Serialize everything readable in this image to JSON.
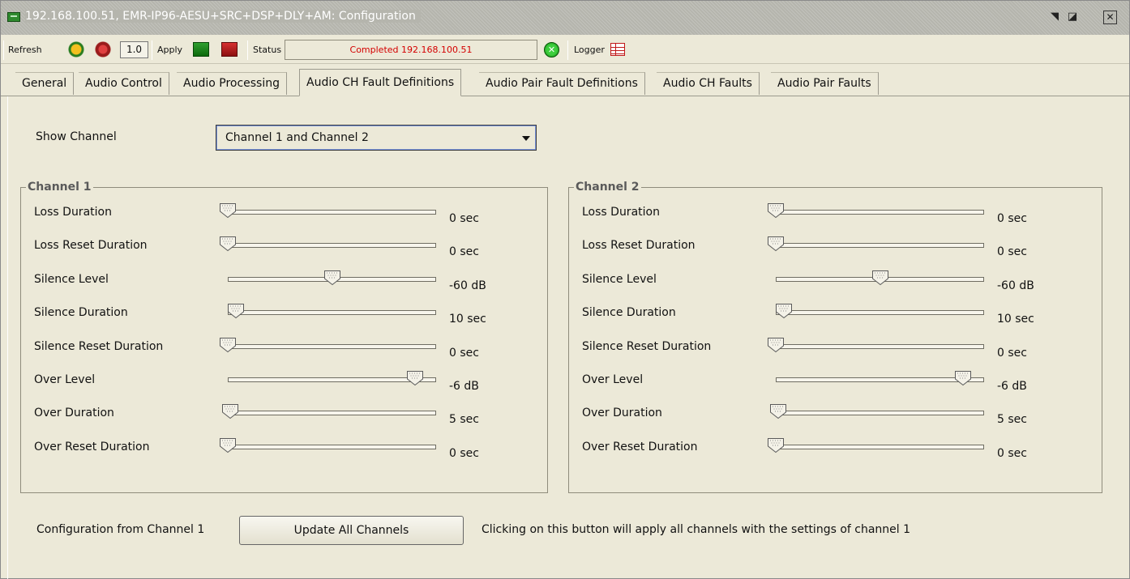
{
  "window": {
    "title": "192.168.100.51, EMR-IP96-AESU+SRC+DSP+DLY+AM: Configuration"
  },
  "toolbar": {
    "refresh_label": "Refresh",
    "version": "1.0",
    "apply_label": "Apply",
    "status_label": "Status",
    "status_text": "Completed 192.168.100.51",
    "logger_label": "Logger"
  },
  "tabs": [
    {
      "label": "General"
    },
    {
      "label": "Audio Control"
    },
    {
      "label": "Audio Processing"
    },
    {
      "label": "Audio CH Fault Definitions",
      "active": true
    },
    {
      "label": "Audio Pair Fault Definitions"
    },
    {
      "label": "Audio CH Faults"
    },
    {
      "label": "Audio Pair Faults"
    }
  ],
  "show_channel": {
    "label": "Show Channel",
    "selected": "Channel 1 and Channel 2"
  },
  "channel1": {
    "title": "Channel 1",
    "rows": [
      {
        "label": "Loss Duration",
        "value": "0 sec",
        "position": 0.0
      },
      {
        "label": "Loss Reset Duration",
        "value": "0 sec",
        "position": 0.0
      },
      {
        "label": "Silence Level",
        "value": "-60 dB",
        "position": 0.5
      },
      {
        "label": "Silence Duration",
        "value": "10 sec",
        "position": 0.04
      },
      {
        "label": "Silence Reset Duration",
        "value": "0 sec",
        "position": 0.0
      },
      {
        "label": "Over Level",
        "value": "-6 dB",
        "position": 0.9
      },
      {
        "label": "Over Duration",
        "value": "5 sec",
        "position": 0.01
      },
      {
        "label": "Over Reset Duration",
        "value": "0 sec",
        "position": 0.0
      }
    ]
  },
  "channel2": {
    "title": "Channel 2",
    "rows": [
      {
        "label": "Loss Duration",
        "value": "0 sec",
        "position": 0.0
      },
      {
        "label": "Loss Reset Duration",
        "value": "0 sec",
        "position": 0.0
      },
      {
        "label": "Silence Level",
        "value": "-60 dB",
        "position": 0.5
      },
      {
        "label": "Silence Duration",
        "value": "10 sec",
        "position": 0.04
      },
      {
        "label": "Silence Reset Duration",
        "value": "0 sec",
        "position": 0.0
      },
      {
        "label": "Over Level",
        "value": "-6 dB",
        "position": 0.9
      },
      {
        "label": "Over Duration",
        "value": "5 sec",
        "position": 0.01
      },
      {
        "label": "Over Reset Duration",
        "value": "0 sec",
        "position": 0.0
      }
    ]
  },
  "footer": {
    "config_label": "Configuration from Channel 1",
    "button_label": "Update All Channels",
    "hint": "Clicking on this button will apply all channels with the settings of channel 1"
  }
}
